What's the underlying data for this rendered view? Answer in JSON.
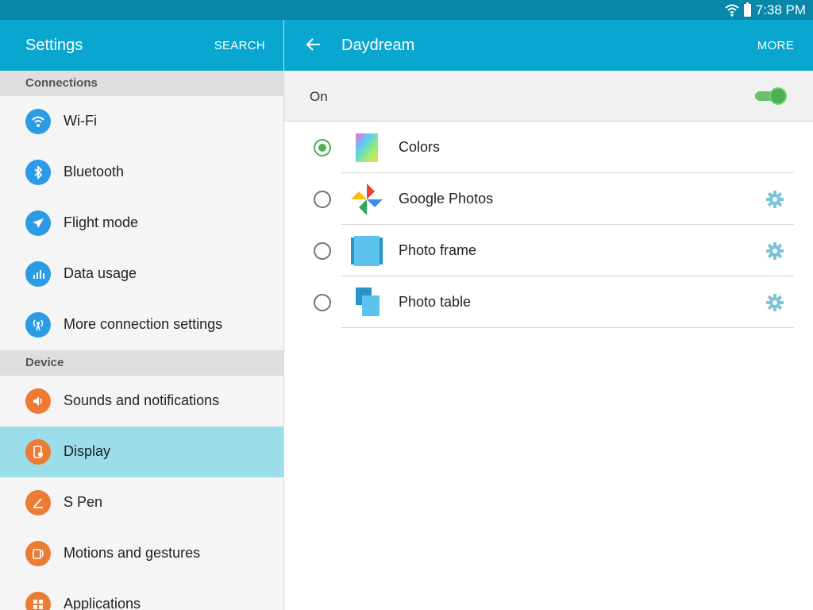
{
  "status_bar": {
    "time": "7:38 PM"
  },
  "settings_header": {
    "title": "Settings",
    "search_label": "SEARCH"
  },
  "detail_header": {
    "title": "Daydream",
    "more_label": "MORE"
  },
  "sidebar": {
    "sections": [
      {
        "title": "Connections",
        "items": [
          {
            "label": "Wi-Fi",
            "icon": "wifi-icon",
            "color": "#2c9be6"
          },
          {
            "label": "Bluetooth",
            "icon": "bluetooth-icon",
            "color": "#2c9be6"
          },
          {
            "label": "Flight mode",
            "icon": "airplane-icon",
            "color": "#2c9be6"
          },
          {
            "label": "Data usage",
            "icon": "bar-chart-icon",
            "color": "#2c9be6"
          },
          {
            "label": "More connection settings",
            "icon": "antenna-icon",
            "color": "#2c9be6"
          }
        ]
      },
      {
        "title": "Device",
        "items": [
          {
            "label": "Sounds and notifications",
            "icon": "speaker-icon",
            "color": "#ec7b34"
          },
          {
            "label": "Display",
            "icon": "display-icon",
            "color": "#ec7b34",
            "selected": true
          },
          {
            "label": "S Pen",
            "icon": "pen-icon",
            "color": "#ec7b34"
          },
          {
            "label": "Motions and gestures",
            "icon": "gesture-icon",
            "color": "#ec7b34"
          },
          {
            "label": "Applications",
            "icon": "apps-grid-icon",
            "color": "#ec7b34"
          }
        ]
      }
    ]
  },
  "daydream": {
    "on_label": "On",
    "enabled": true,
    "options": [
      {
        "label": "Colors",
        "icon": "colors-thumb-icon",
        "selected": true,
        "has_settings": false
      },
      {
        "label": "Google Photos",
        "icon": "google-photos-icon",
        "selected": false,
        "has_settings": true
      },
      {
        "label": "Photo frame",
        "icon": "photo-frame-icon",
        "selected": false,
        "has_settings": true
      },
      {
        "label": "Photo table",
        "icon": "photo-table-icon",
        "selected": false,
        "has_settings": true
      }
    ]
  },
  "colors": {
    "accent": "#09a6cf",
    "status_bar": "#0887a8",
    "selected_row": "#9bdde9",
    "toggle_on": "#4caf50"
  }
}
